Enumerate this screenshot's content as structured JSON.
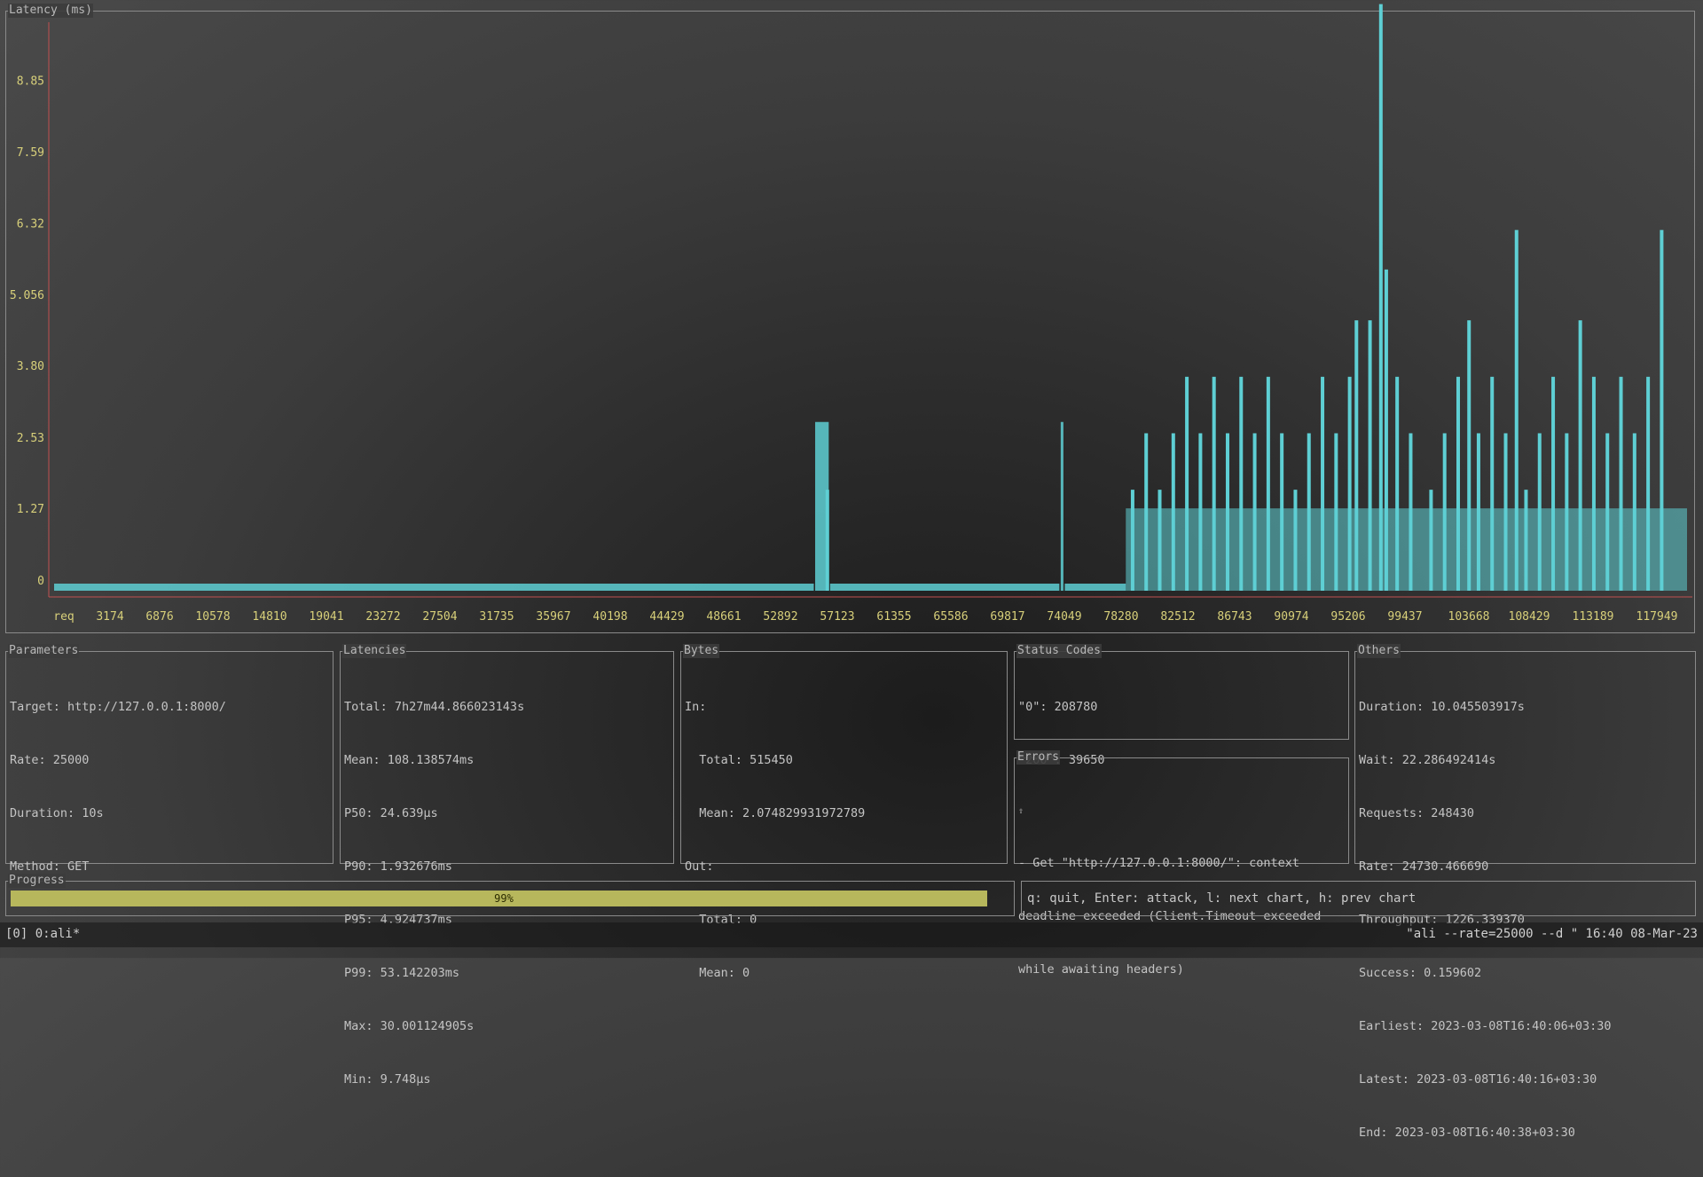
{
  "chart": {
    "title": "Latency (ms)",
    "colors": {
      "axis": "#c05050",
      "bars": "#5ecfd4",
      "labels": "#d8d07a"
    }
  },
  "chart_data": {
    "type": "bar",
    "title": "Latency (ms)",
    "xlabel": "req",
    "ylabel": "",
    "y_ticks": [
      "0",
      "1.27",
      "2.53",
      "3.80",
      "5.056",
      "6.32",
      "7.59",
      "8.85"
    ],
    "x_ticks": [
      "req",
      "3174",
      "6876",
      "10578",
      "14810",
      "19041",
      "23272",
      "27504",
      "31735",
      "35967",
      "40198",
      "44429",
      "48661",
      "52892",
      "57123",
      "61355",
      "65586",
      "69817",
      "74049",
      "78280",
      "82512",
      "86743",
      "90974",
      "95206",
      "99437",
      "103668",
      "108429",
      "113189",
      "117949"
    ],
    "ylim": [
      0,
      10.1
    ],
    "segments": [
      {
        "x_from": 0,
        "x_to": 56000,
        "y": 0
      },
      {
        "x_from": 56100,
        "x_to": 57100,
        "y": 2.8
      },
      {
        "x_from": 57200,
        "x_to": 74100,
        "y": 0
      },
      {
        "x_from": 74200,
        "x_to": 74400,
        "y": 2.8
      },
      {
        "x_from": 74500,
        "x_to": 79000,
        "y": 0
      }
    ],
    "spikes": [
      {
        "x": 57000,
        "y": 1.6
      },
      {
        "x": 79500,
        "y": 1.6
      },
      {
        "x": 80500,
        "y": 2.6
      },
      {
        "x": 81500,
        "y": 1.6
      },
      {
        "x": 82500,
        "y": 2.6
      },
      {
        "x": 83500,
        "y": 3.6
      },
      {
        "x": 84500,
        "y": 2.6
      },
      {
        "x": 85500,
        "y": 3.6
      },
      {
        "x": 86500,
        "y": 2.6
      },
      {
        "x": 87500,
        "y": 3.6
      },
      {
        "x": 88500,
        "y": 2.6
      },
      {
        "x": 89500,
        "y": 3.6
      },
      {
        "x": 90500,
        "y": 2.6
      },
      {
        "x": 91500,
        "y": 1.6
      },
      {
        "x": 92500,
        "y": 2.6
      },
      {
        "x": 93500,
        "y": 3.6
      },
      {
        "x": 94500,
        "y": 2.6
      },
      {
        "x": 95500,
        "y": 3.6
      },
      {
        "x": 96000,
        "y": 4.6
      },
      {
        "x": 97000,
        "y": 4.6
      },
      {
        "x": 97800,
        "y": 10.2
      },
      {
        "x": 98200,
        "y": 5.5
      },
      {
        "x": 99000,
        "y": 3.6
      },
      {
        "x": 100000,
        "y": 2.6
      },
      {
        "x": 101500,
        "y": 1.6
      },
      {
        "x": 102500,
        "y": 2.6
      },
      {
        "x": 103500,
        "y": 3.6
      },
      {
        "x": 104300,
        "y": 4.6
      },
      {
        "x": 105000,
        "y": 2.6
      },
      {
        "x": 106000,
        "y": 3.6
      },
      {
        "x": 107000,
        "y": 2.6
      },
      {
        "x": 107800,
        "y": 6.2
      },
      {
        "x": 108500,
        "y": 1.6
      },
      {
        "x": 109500,
        "y": 2.6
      },
      {
        "x": 110500,
        "y": 3.6
      },
      {
        "x": 111500,
        "y": 2.6
      },
      {
        "x": 112500,
        "y": 4.6
      },
      {
        "x": 113500,
        "y": 3.6
      },
      {
        "x": 114500,
        "y": 2.6
      },
      {
        "x": 115500,
        "y": 3.6
      },
      {
        "x": 116500,
        "y": 2.6
      },
      {
        "x": 117500,
        "y": 3.6
      },
      {
        "x": 118500,
        "y": 6.2
      }
    ],
    "grid": false
  },
  "panels": {
    "parameters": {
      "title": "Parameters",
      "lines": [
        "Target: http://127.0.0.1:8000/",
        "Rate: 25000",
        "Duration: 10s",
        "Method: GET"
      ]
    },
    "latencies": {
      "title": "Latencies",
      "lines": [
        "Total: 7h27m44.866023143s",
        "Mean: 108.138574ms",
        "P50: 24.639µs",
        "P90: 1.932676ms",
        "P95: 4.924737ms",
        "P99: 53.142203ms",
        "Max: 30.001124905s",
        "Min: 9.748µs"
      ]
    },
    "bytes": {
      "title": "Bytes",
      "lines": [
        "In:",
        "  Total: 515450",
        "  Mean: 2.074829931972789",
        "Out:",
        "  Total: 0",
        "  Mean: 0"
      ]
    },
    "status_codes": {
      "title": "Status Codes",
      "lines": [
        "\"0\": 208780",
        "\"200\": 39650"
      ]
    },
    "errors": {
      "title": "Errors",
      "lines": [
        "⇧",
        "- Get \"http://127.0.0.1:8000/\": context",
        "deadline exceeded (Client.Timeout exceeded",
        "while awaiting headers)"
      ]
    },
    "others": {
      "title": "Others",
      "lines": [
        "Duration: 10.045503917s",
        "Wait: 22.286492414s",
        "Requests: 248430",
        "Rate: 24730.466690",
        "Throughput: 1226.339370",
        "Success: 0.159602",
        "Earliest: 2023-03-08T16:40:06+03:30",
        "Latest: 2023-03-08T16:40:16+03:30",
        "End: 2023-03-08T16:40:38+03:30"
      ]
    }
  },
  "progress": {
    "title": "Progress",
    "percent": 99,
    "label": "99%",
    "color": "#b7b75c"
  },
  "help": {
    "text": "q: quit, Enter: attack, l: next chart, h: prev chart"
  },
  "statusbar": {
    "left": "[0] 0:ali*",
    "right": "\"ali --rate=25000 --d \" 16:40 08-Mar-23"
  }
}
